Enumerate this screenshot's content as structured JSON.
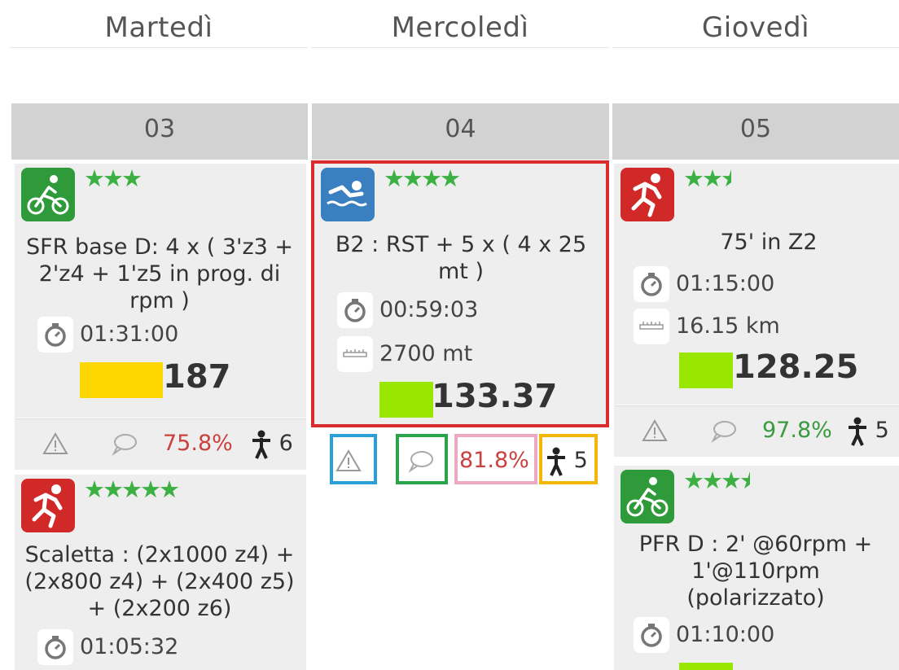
{
  "days": [
    {
      "name": "Martedì",
      "date": "03"
    },
    {
      "name": "Mercoledì",
      "date": "04"
    },
    {
      "name": "Giovedì",
      "date": "05"
    }
  ],
  "cards": {
    "tue_1": {
      "sport": "bike-icon",
      "stars": "★★★",
      "title": "SFR base D: 4 x ( 3'z3 + 2'z4 + 1'z5 in prog. di rpm )",
      "duration": "01:31:00",
      "tss": "187",
      "tss_bar_color": "#ffd700",
      "compliance": "75.8%",
      "people": "6"
    },
    "tue_2": {
      "sport": "run-icon",
      "stars": "★★★★★",
      "title": "Scaletta : (2x1000 z4) + (2x800 z4) + (2x400 z5) + (2x200 z6)",
      "duration": "01:05:32"
    },
    "wed_1": {
      "sport": "swim-icon",
      "stars": "★★★★",
      "title": "B2 : RST + 5 x ( 4 x 25 mt )",
      "duration": "00:59:03",
      "distance": "2700 mt",
      "tss": "133.37",
      "tss_bar_color": "#99e600",
      "compliance": "81.8%",
      "people": "5"
    },
    "thu_1": {
      "sport": "run-icon",
      "stars": "★★",
      "title": "75' in Z2",
      "duration": "01:15:00",
      "distance": "16.15 km",
      "tss": "128.25",
      "tss_bar_color": "#99e600",
      "compliance": "97.8%",
      "people": "5"
    },
    "thu_2": {
      "sport": "bike-icon",
      "stars": "★★★",
      "title": "PFR D : 2' @60rpm + 1'@110rpm (polarizzato)",
      "duration": "01:10:00",
      "tss_bar_color": "#99e600"
    }
  },
  "colors": {
    "bike": "#2f9a3a",
    "run": "#d12828",
    "swim": "#3a7fc0",
    "stars": "#3cb043",
    "highlight_card": "#d92c2c",
    "highlight_warning": "#2a9fd8",
    "highlight_comment": "#2ba34a",
    "highlight_compliance": "#f0a8c0",
    "highlight_people": "#f2b705"
  }
}
